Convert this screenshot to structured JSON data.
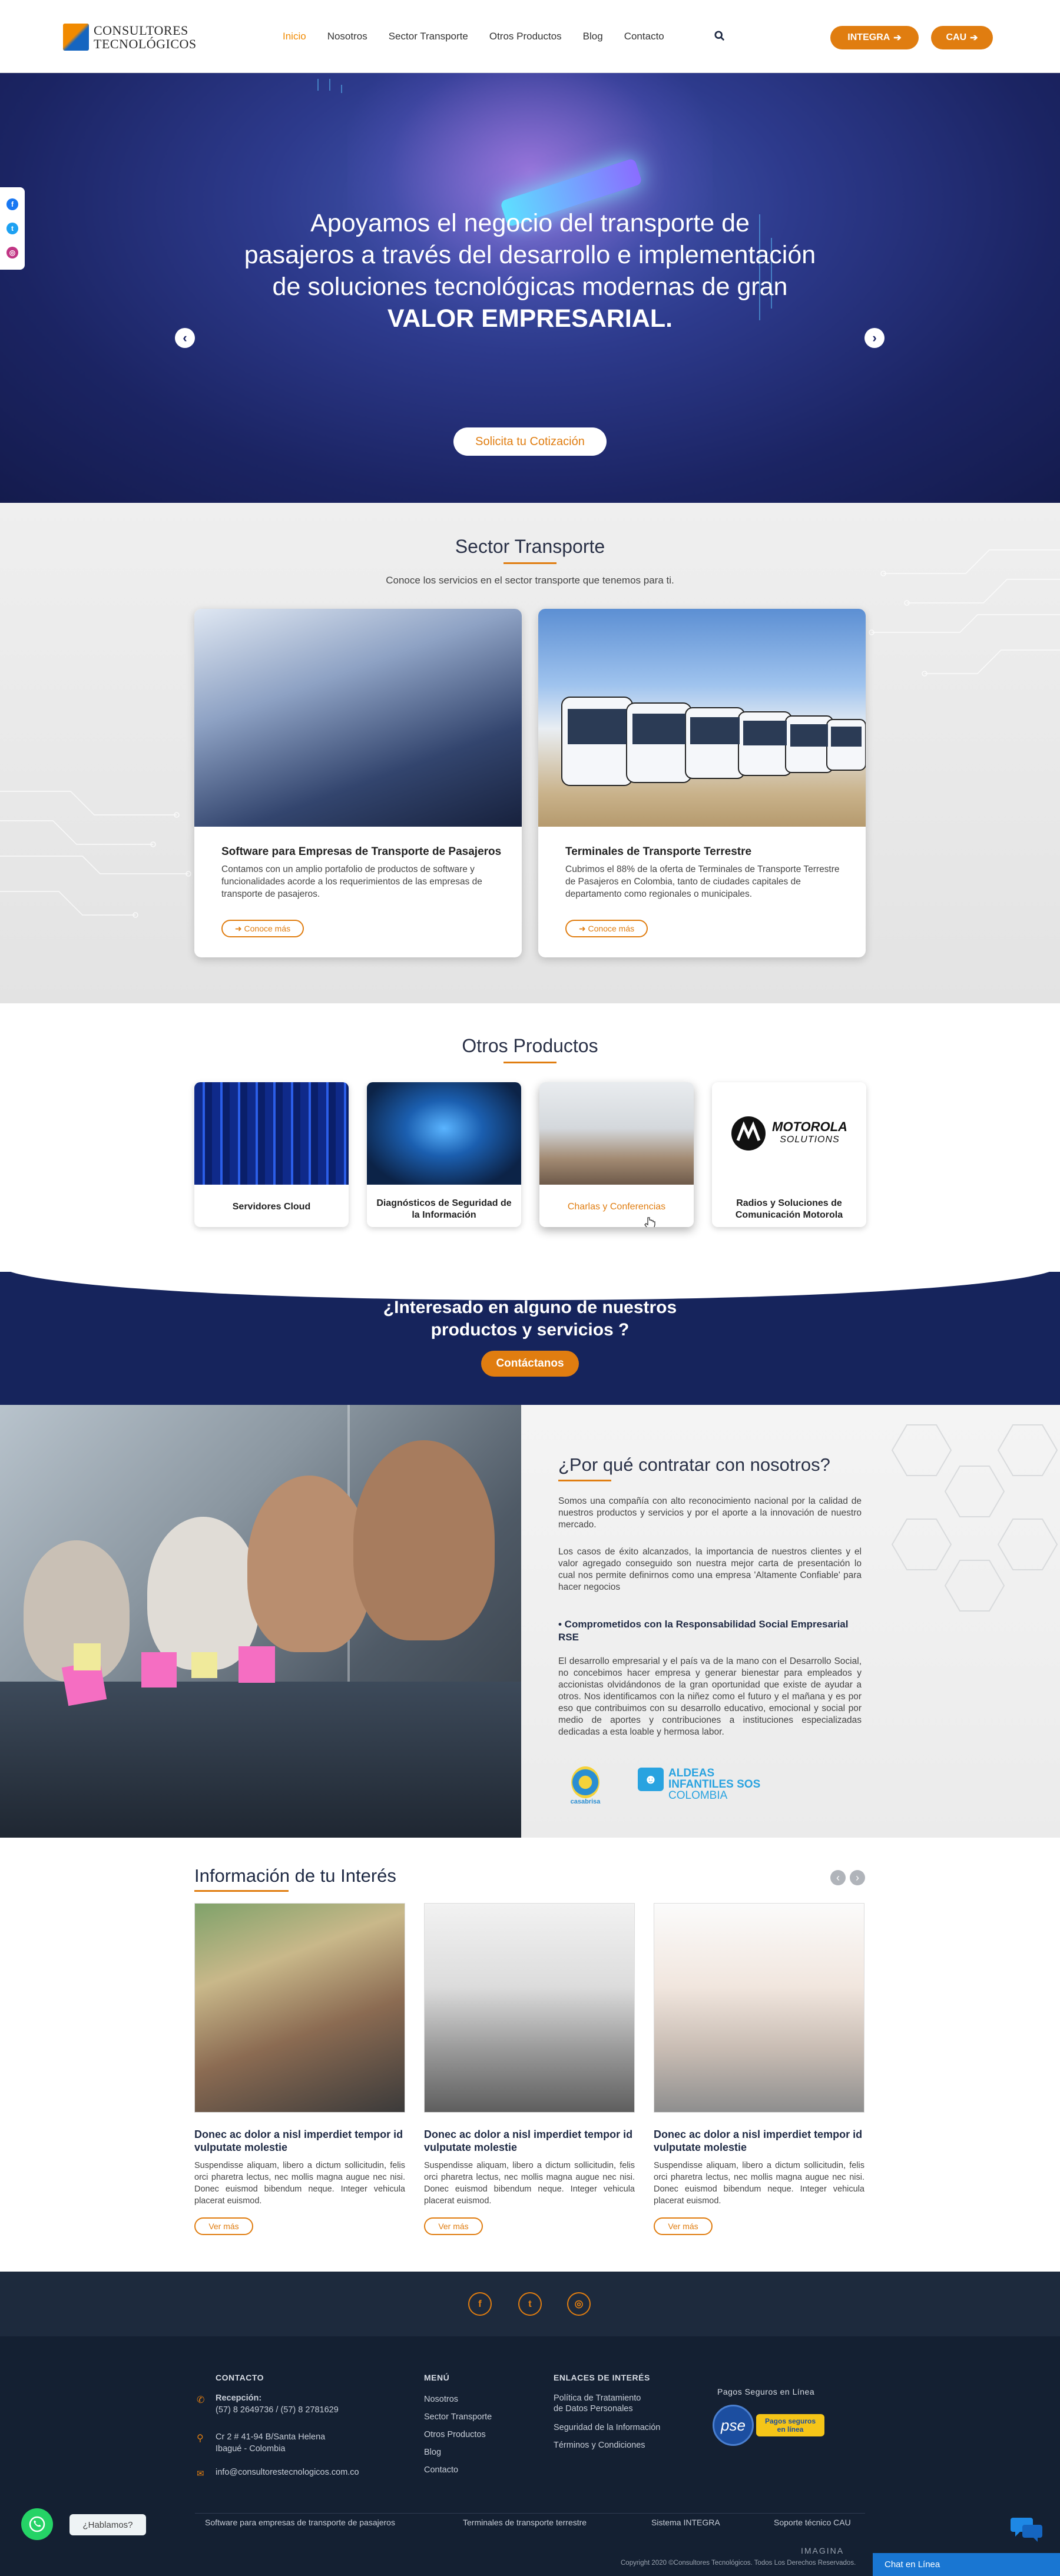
{
  "header": {
    "logo_line1": "CONSULTORES",
    "logo_line2": "TECNOLÓGICOS",
    "nav": [
      "Inicio",
      "Nosotros",
      "Sector Transporte",
      "Otros Productos",
      "Blog",
      "Contacto"
    ],
    "integra_label": "INTEGRA",
    "cau_label": "CAU"
  },
  "hero": {
    "line1": "Apoyamos el negocio del transporte de",
    "line2": "pasajeros a través del desarrollo e implementación",
    "line3": "de soluciones tecnológicas modernas de gran",
    "line4": "VALOR EMPRESARIAL.",
    "button": "Solicita tu Cotización"
  },
  "sector": {
    "title": "Sector Transporte",
    "subtitle": "Conoce los servicios en el sector transporte que tenemos para ti.",
    "cards": [
      {
        "title": "Software para Empresas de Transporte de Pasajeros",
        "text": "Contamos con un amplio portafolio de productos de software y funcionalidades acorde a los requerimientos de las empresas de transporte de pasajeros.",
        "button": "Conoce más"
      },
      {
        "title": "Terminales de Transporte Terrestre",
        "text": "Cubrimos el 88% de la oferta de Terminales de Transporte Terrestre de Pasajeros en Colombia, tanto de ciudades capitales de departamento como regionales o municipales.",
        "button": "Conoce más"
      }
    ]
  },
  "otros": {
    "title": "Otros Productos",
    "items": [
      {
        "label": "Servidores Cloud"
      },
      {
        "label": "Diagnósticos de Seguridad de la Información"
      },
      {
        "label": "Charlas y Conferencias"
      },
      {
        "label": "Radios y Soluciones de Comunicación Motorola"
      }
    ],
    "motorola_text": "MOTOROLA",
    "motorola_sub": "SOLUTIONS"
  },
  "cta": {
    "title": "¿Interesado en alguno de nuestros productos y servicios ?",
    "button": "Contáctanos"
  },
  "why": {
    "title": "¿Por qué contratar con nosotros?",
    "p1": "Somos una compañía con alto reconocimiento nacional por la calidad de nuestros productos y servicios y por el aporte a la innovación de nuestro mercado.",
    "p2": "Los casos de éxito alcanzados, la importancia de nuestros clientes y el valor agregado conseguido son nuestra mejor carta de presentación lo cual nos permite definirnos como una empresa 'Altamente Confiable' para hacer negocios",
    "rse_title": "• Comprometidos con la Responsabilidad Social Empresarial RSE",
    "p3": "El desarrollo empresarial y el país va de la mano con el Desarrollo Social, no concebimos hacer empresa y generar bienestar para empleados y accionistas olvidándonos de la gran oportunidad que existe de ayudar a otros. Nos identificamos con la niñez como el futuro y el mañana y es por eso que contribuimos con su desarrollo educativo, emocional y social por medio de aportes y contribuciones a instituciones especializadas dedicadas a esta loable y hermosa labor.",
    "logo1": "casabrisa",
    "logo2_line1": "ALDEAS",
    "logo2_line2": "INFANTILES SOS",
    "logo2_line3": "COLOMBIA"
  },
  "info": {
    "title": "Información de tu Interés",
    "posts": [
      {
        "title": "Donec ac dolor a nisl imperdiet tempor id vulputate molestie",
        "text": "Suspendisse aliquam, libero a dictum sollicitudin, felis orci pharetra lectus, nec mollis magna augue nec nisi. Donec euismod bibendum neque. Integer vehicula placerat euismod.",
        "button": "Ver más"
      },
      {
        "title": "Donec ac dolor a nisl imperdiet tempor id vulputate molestie",
        "text": "Suspendisse aliquam, libero a dictum sollicitudin, felis orci pharetra lectus, nec mollis magna augue nec nisi. Donec euismod bibendum neque. Integer vehicula placerat euismod.",
        "button": "Ver más"
      },
      {
        "title": "Donec ac dolor a nisl imperdiet tempor id vulputate molestie",
        "text": "Suspendisse aliquam, libero a dictum sollicitudin, felis orci pharetra lectus, nec mollis magna augue nec nisi. Donec euismod bibendum neque. Integer vehicula placerat euismod.",
        "button": "Ver más"
      }
    ]
  },
  "footer": {
    "contacto_h": "CONTACTO",
    "recepcion_label": "Recepción:",
    "phones": "(57) 8 2649736 / (57) 8 2781629",
    "address1": "Cr 2 # 41-94 B/Santa Helena",
    "address2": "Ibagué - Colombia",
    "email": "info@consultorestecnologicos.com.co",
    "menu_h": "MENÚ",
    "menu": [
      "Nosotros",
      "Sector Transporte",
      "Otros Productos",
      "Blog",
      "Contacto"
    ],
    "enlaces_h": "ENLACES DE INTERÉS",
    "enlace1_line1": "Política de Tratamiento",
    "enlace1_line2": "de Datos Personales",
    "enlace2": "Seguridad de la Información",
    "enlace3": "Términos y Condiciones",
    "pagos_h": "Pagos Seguros en Línea",
    "pse_text": "pse",
    "pse_badge_line1": "Pagos seguros",
    "pse_badge_line2": "en línea",
    "bottom_links": [
      "Software para empresas de transporte de pasajeros",
      "Terminales de transporte terrestre",
      "Sistema INTEGRA",
      "Soporte técnico CAU"
    ],
    "brand": "IMAGINA",
    "copyright": "Copyright 2020 ©Consultores Tecnológicos. Todos Los Derechos Reservados.",
    "chat": "Chat en Línea",
    "whatsapp_bubble": "¿Hablamos?"
  },
  "colors": {
    "accent": "#e07d10",
    "navy": "#16245c",
    "footer": "#142032"
  },
  "icons": [
    "search-icon",
    "arrow-left-icon",
    "arrow-right-icon",
    "facebook-icon",
    "twitter-icon",
    "instagram-icon",
    "whatsapp-icon",
    "chat-icon",
    "phone-icon",
    "location-icon",
    "email-icon"
  ]
}
